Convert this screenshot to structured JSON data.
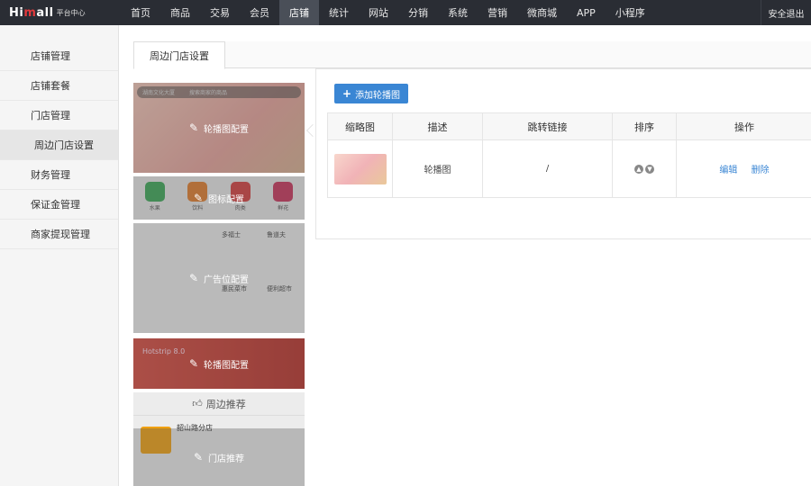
{
  "logo": {
    "brand_pre": "Hi",
    "brand_o": "m",
    "brand_post": "all",
    "subtitle": "平台中心"
  },
  "nav": {
    "items": [
      "首页",
      "商品",
      "交易",
      "会员",
      "店铺",
      "统计",
      "网站",
      "分销",
      "系统",
      "营销",
      "微商城",
      "APP",
      "小程序"
    ],
    "active_index": 4,
    "logout": "安全退出"
  },
  "sidebar": {
    "items": [
      "店铺管理",
      "店铺套餐",
      "门店管理",
      "周边门店设置",
      "财务管理",
      "保证金管理",
      "商家提现管理"
    ],
    "active_index": 3
  },
  "tab": {
    "label": "周边门店设置"
  },
  "preview": {
    "search_location": "湖南文化大厦",
    "search_placeholder": "搜索商家的商品",
    "banner_overlay": "轮播图配置",
    "icons_overlay": "图标配置",
    "icons": [
      "水果",
      "饮料",
      "肉类",
      "鲜花"
    ],
    "ad_overlay": "广告位配置",
    "ad_cells": [
      "多福士",
      "鲁道夫",
      "惠民菜市",
      "便利超市"
    ],
    "banner2_title": "Hotstrip 8.0",
    "banner2_overlay": "轮播图配置",
    "nearby_header": "周边推荐",
    "shop_name": "韶山路分店",
    "nearby_overlay": "门店推荐"
  },
  "panel": {
    "add_button": "添加轮播图",
    "columns": [
      "缩略图",
      "描述",
      "跳转链接",
      "排序",
      "操作"
    ],
    "rows": [
      {
        "desc": "轮播图",
        "link": "/",
        "edit": "编辑",
        "delete": "删除"
      }
    ]
  },
  "colors": {
    "accent": "#3a86d4",
    "topbar": "#2a2d34",
    "brand_red": "#e4393c"
  }
}
